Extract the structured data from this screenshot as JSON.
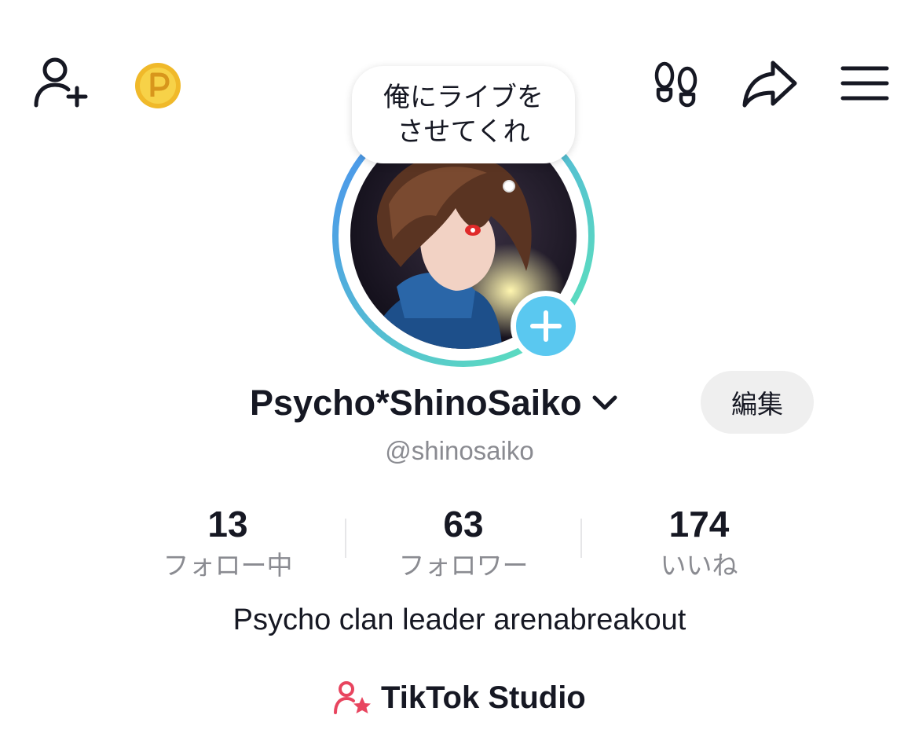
{
  "profile": {
    "status_bubble": {
      "line1": "俺にライブを",
      "line2": "させてくれ"
    },
    "display_name": "Psycho*ShinoSaiko",
    "username": "@shinosaiko",
    "edit_label": "編集",
    "bio": "Psycho clan leader arenabreakout"
  },
  "stats": [
    {
      "value": "13",
      "label": "フォロー中"
    },
    {
      "value": "63",
      "label": "フォロワー"
    },
    {
      "value": "174",
      "label": "いいね"
    }
  ],
  "studio": {
    "label": "TikTok Studio",
    "icon": "person-star-icon"
  },
  "top_bar": {
    "icons": [
      "add-friend-icon",
      "coin-icon",
      "footprints-icon",
      "share-icon",
      "menu-icon"
    ]
  },
  "colors": {
    "accent_blue": "#5ac8f0",
    "ring_gradient_start": "#4a8ef0",
    "ring_gradient_end": "#5ee8b8",
    "coin_gold": "#f5c736",
    "studio_pink": "#e8455f",
    "muted_text": "#8a8b91"
  }
}
